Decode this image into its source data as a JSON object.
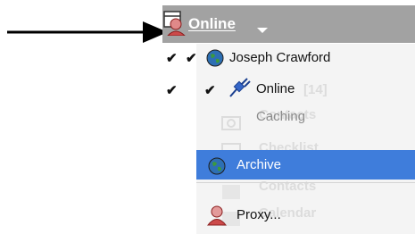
{
  "header": {
    "title": "Online"
  },
  "menu": {
    "items": [
      {
        "label": "Joseph Crawford",
        "checked": true,
        "icon": "globe-icon"
      },
      {
        "label": "Online",
        "checked": true,
        "icon": "plug-icon"
      },
      {
        "label": "Caching"
      },
      {
        "label": "Archive",
        "icon": "globe-icon",
        "selected": true
      },
      {
        "label": "Proxy...",
        "icon": "user-icon"
      }
    ]
  },
  "background_ghost": {
    "items": [
      "[14]",
      "Contacts",
      "Checklist",
      "Contacts",
      "Calendar"
    ]
  },
  "colors": {
    "header_bg": "#a2a2a2",
    "selected_bg": "#3f7ddb",
    "menu_bg": "#f4f4f4"
  }
}
